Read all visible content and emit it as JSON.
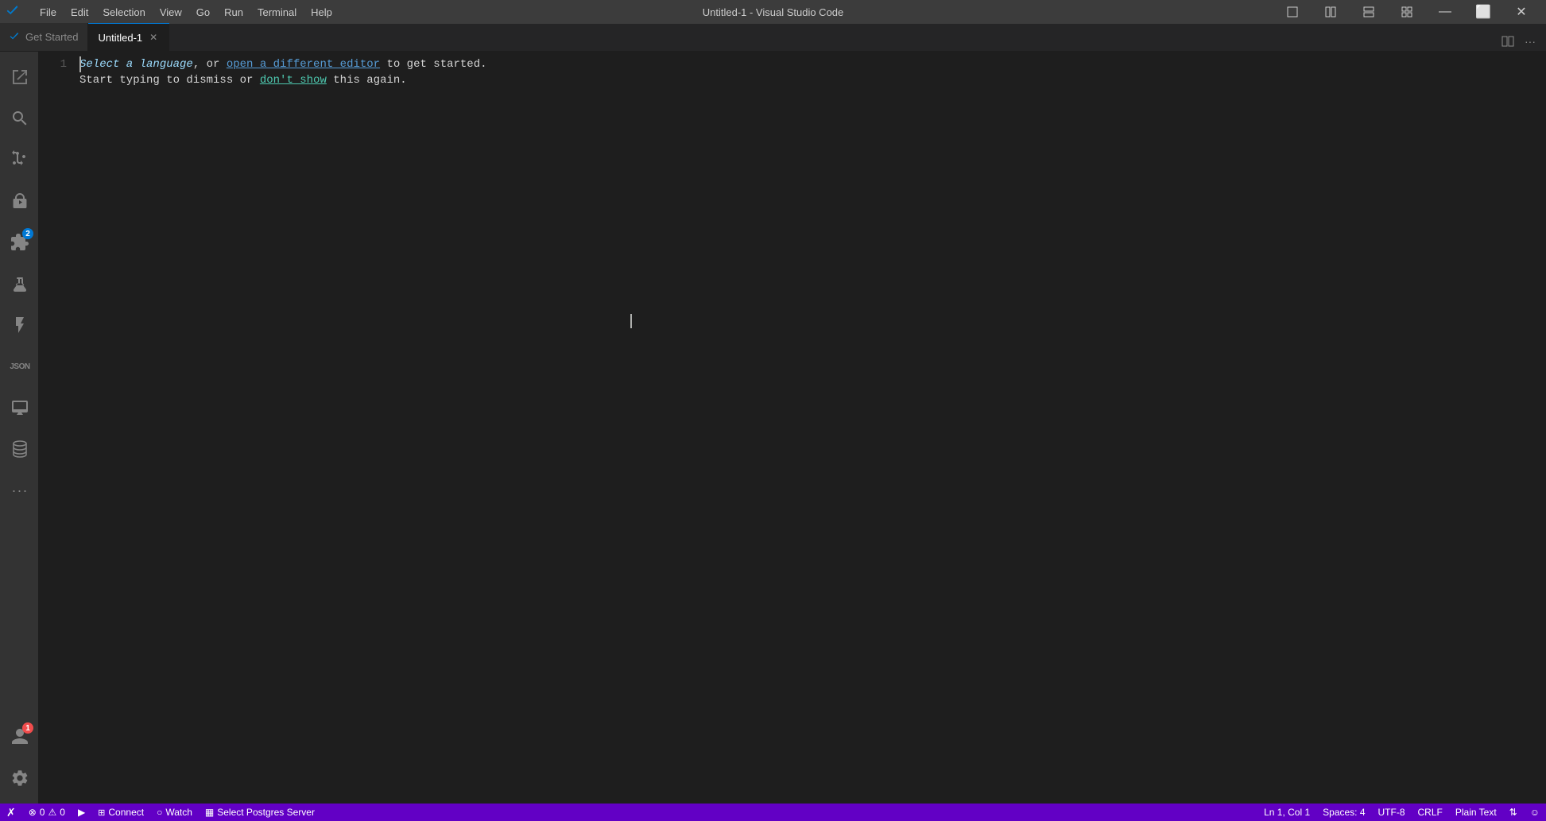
{
  "title_bar": {
    "title": "Untitled-1 - Visual Studio Code",
    "menu_items": [
      "File",
      "Edit",
      "Selection",
      "View",
      "Go",
      "Run",
      "Terminal",
      "Help"
    ],
    "controls": {
      "minimize": "—",
      "maximize": "⬜",
      "restore": "❐",
      "close": "✕"
    }
  },
  "tabs": {
    "get_started": "Get Started",
    "active_tab": "Untitled-1",
    "close_icon": "✕",
    "layout_icon": "⊞",
    "more_icon": "···"
  },
  "activity_bar": {
    "items": [
      {
        "name": "explorer",
        "icon": "files"
      },
      {
        "name": "search",
        "icon": "search"
      },
      {
        "name": "source-control",
        "icon": "git"
      },
      {
        "name": "debug",
        "icon": "debug"
      },
      {
        "name": "extensions",
        "icon": "extensions",
        "badge": "2"
      },
      {
        "name": "testing",
        "icon": "testing"
      },
      {
        "name": "lightning",
        "icon": "lightning"
      },
      {
        "name": "json",
        "icon": "json"
      },
      {
        "name": "monitor",
        "icon": "monitor"
      },
      {
        "name": "database",
        "icon": "database"
      },
      {
        "name": "more",
        "icon": "ellipsis"
      }
    ],
    "bottom_items": [
      {
        "name": "account",
        "icon": "person",
        "badge": "1"
      },
      {
        "name": "settings",
        "icon": "gear"
      }
    ]
  },
  "editor": {
    "line_number": "1",
    "line1_text": "Select a language, or open a different editor to get started.",
    "line2_text": "Start typing to dismiss or don't show this again.",
    "select_text": "Select a language",
    "open_text": "open a different editor",
    "dont_show_text": "don't show"
  },
  "status_bar": {
    "color": "#6200c5",
    "vscode_icon": "✗",
    "errors": "0",
    "warnings": "0",
    "run_icon": "▶",
    "connect": "Connect",
    "watch_icon": "○",
    "watch": "Watch",
    "postgres_icon": "▦",
    "postgres": "Select Postgres Server",
    "right_items": [
      {
        "label": "Ln 1, Col 1"
      },
      {
        "label": "Spaces: 4"
      },
      {
        "label": "UTF-8"
      },
      {
        "label": "CRLF"
      },
      {
        "label": "Plain Text"
      },
      {
        "label": "⇅"
      },
      {
        "label": "☺"
      }
    ]
  }
}
